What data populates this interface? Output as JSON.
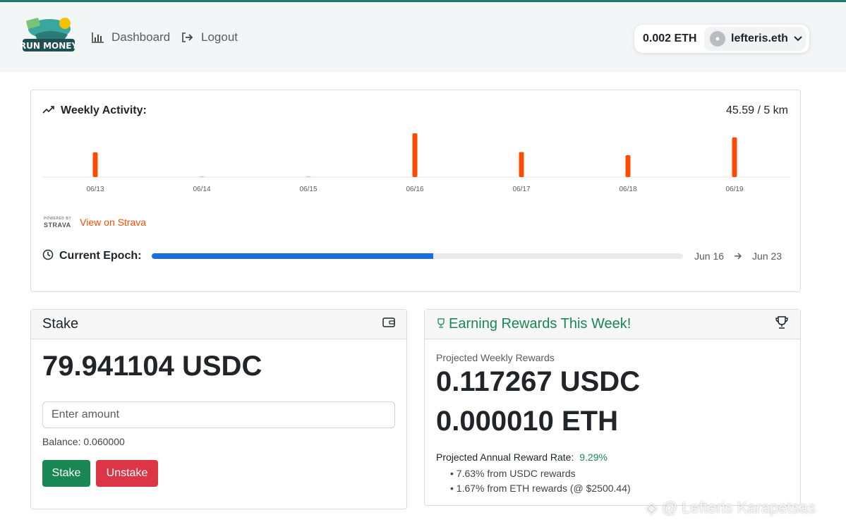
{
  "nav": {
    "logo_text": "RUN MONEY",
    "dashboard_label": "Dashboard",
    "logout_label": "Logout",
    "wallet_balance": "0.002 ETH",
    "account_name": "lefteris.eth"
  },
  "activity": {
    "title": "Weekly Activity:",
    "total": "45.59 / 5 km",
    "strava_logo": "STRAVA",
    "strava_link": "View on Strava"
  },
  "chart_data": {
    "type": "bar",
    "categories": [
      "06/13",
      "06/14",
      "06/15",
      "06/16",
      "06/17",
      "06/18",
      "06/19"
    ],
    "values": [
      6.9,
      0.1,
      0.1,
      12.2,
      7.0,
      6.1,
      11.1
    ],
    "ylim": [
      0,
      13
    ],
    "grid": false,
    "legend": "none",
    "bar_color": "#fc4c02"
  },
  "epoch": {
    "label": "Current Epoch:",
    "progress": 0.53,
    "start": "Jun 16",
    "end": "Jun 23"
  },
  "stake": {
    "title": "Stake",
    "amount": "79.941104 USDC",
    "input_placeholder": "Enter amount",
    "balance": "Balance: 0.060000",
    "stake_button": "Stake",
    "unstake_button": "Unstake"
  },
  "rewards": {
    "title": "Earning Rewards This Week!",
    "projected_label": "Projected Weekly Rewards",
    "usdc": "0.117267 USDC",
    "eth": "0.000010 ETH",
    "rate_label": "Projected Annual Reward Rate:",
    "rate_value": "9.29%",
    "bullets": [
      "7.63% from USDC rewards",
      "1.67% from ETH rewards (@ $2500.44)"
    ]
  },
  "watermark": "@ Lefteris Karapetsas",
  "colors": {
    "accent_blue": "#1a6fe0",
    "success": "#198754",
    "danger": "#dc3545",
    "strava": "#fc4c02"
  }
}
